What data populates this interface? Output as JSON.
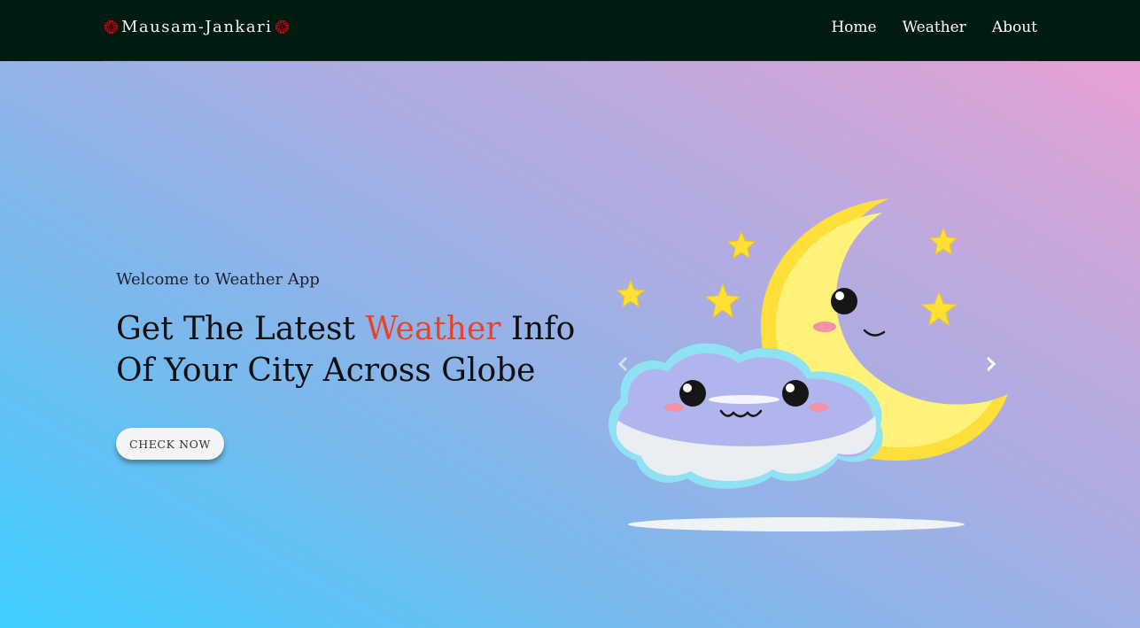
{
  "brand": {
    "name": "Mausam-Jankari",
    "icon_left": "sun-icon",
    "icon_right": "sun-icon",
    "icon_color": "#c4141c"
  },
  "nav": [
    {
      "label": "Home"
    },
    {
      "label": "Weather"
    },
    {
      "label": "About"
    }
  ],
  "hero": {
    "welcome": "Welcome to Weather App",
    "headline_part1": "Get The Latest ",
    "headline_accent": "Weather",
    "headline_part2": " Info",
    "headline_line2": "Of Your City Across Globe",
    "cta_label": "CHECK NOW",
    "accent_color": "#e8432a"
  },
  "carousel": {
    "image": "cloud-moon-illustration",
    "prev_icon": "chevron-left-icon",
    "next_icon": "chevron-right-icon"
  },
  "colors": {
    "navbar_bg": "#021b10",
    "gradient_start": "#3ecfff",
    "gradient_end": "#f29fd2"
  }
}
